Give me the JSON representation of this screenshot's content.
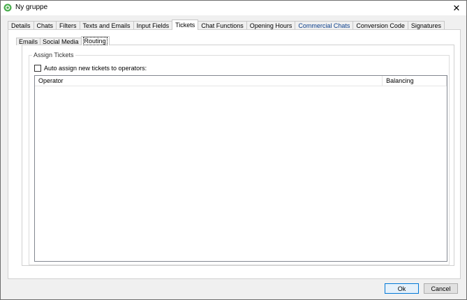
{
  "window": {
    "title": "Ny gruppe",
    "close_glyph": "✕",
    "icon": "app-logo-icon",
    "accent": "#4caf50"
  },
  "tabs": [
    {
      "label": "Details"
    },
    {
      "label": "Chats"
    },
    {
      "label": "Filters"
    },
    {
      "label": "Texts and Emails"
    },
    {
      "label": "Input Fields"
    },
    {
      "label": "Tickets",
      "active": true
    },
    {
      "label": "Chat Functions"
    },
    {
      "label": "Opening Hours"
    },
    {
      "label": "Commercial Chats",
      "highlight_color": "#0b3e8a"
    },
    {
      "label": "Conversion Code"
    },
    {
      "label": "Signatures"
    }
  ],
  "subtabs": [
    {
      "label": "Emails"
    },
    {
      "label": "Social Media"
    },
    {
      "label": "Routing",
      "active": true
    }
  ],
  "assign_tickets": {
    "legend": "Assign Tickets",
    "checkbox_label": "Auto assign new tickets to operators:",
    "checked": false,
    "columns": [
      "Operator",
      "Balancing"
    ],
    "rows": []
  },
  "buttons": {
    "ok": "Ok",
    "cancel": "Cancel"
  }
}
